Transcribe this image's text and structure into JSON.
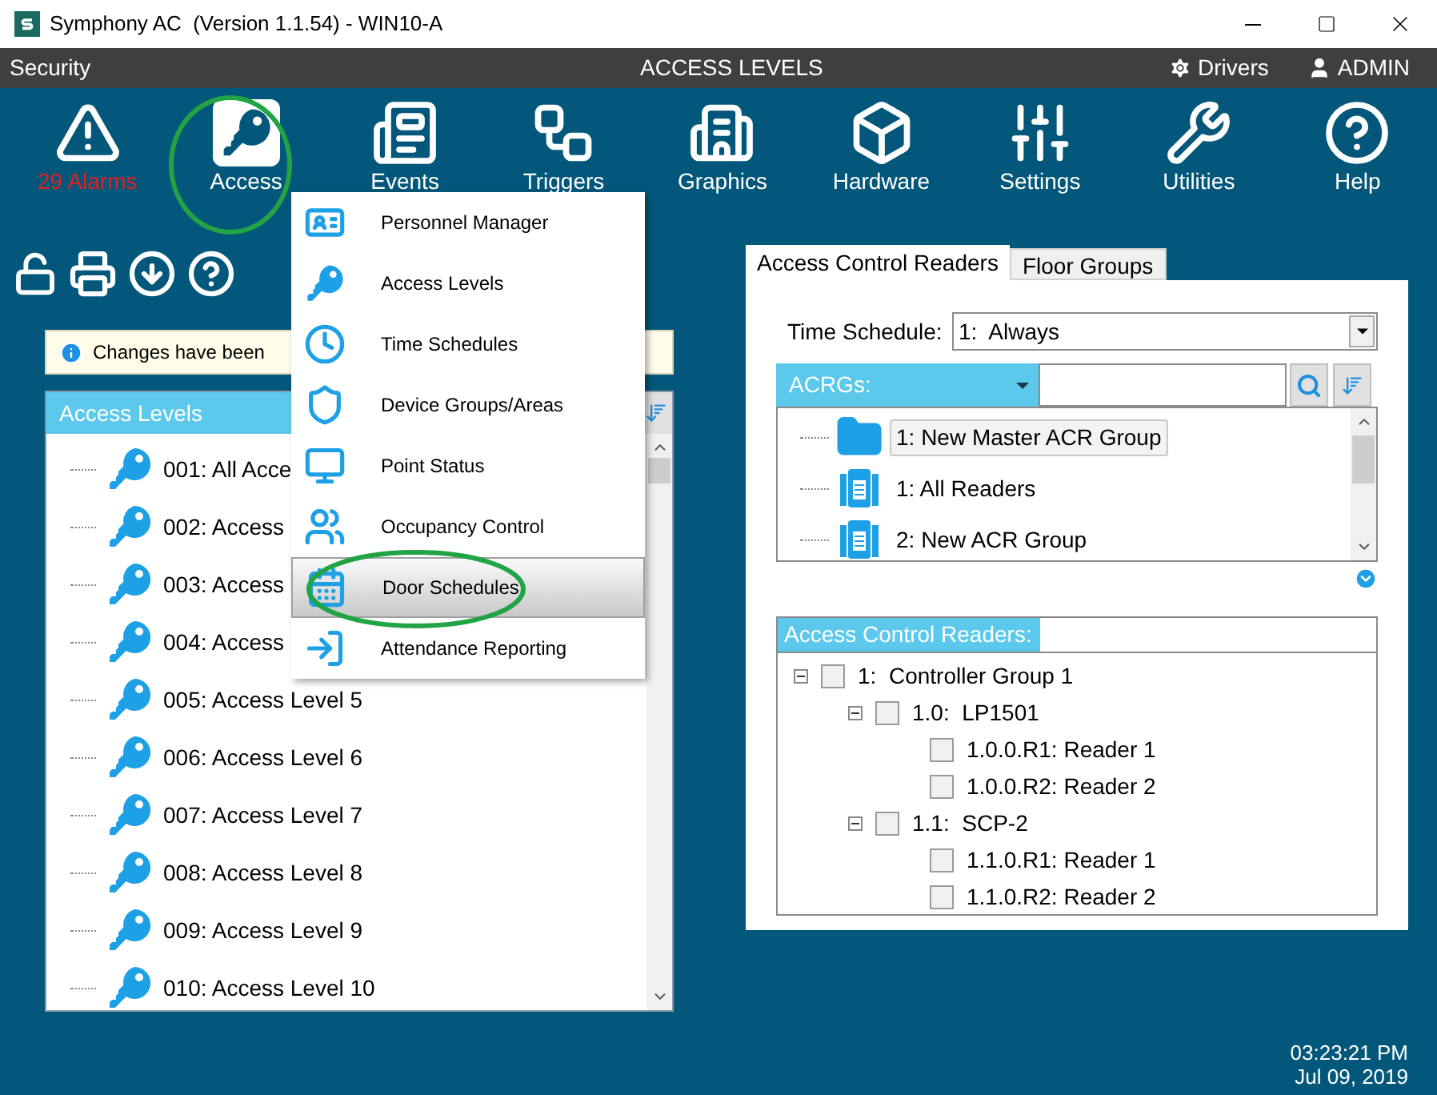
{
  "window": {
    "title": "Symphony AC  (Version 1.1.54) - WIN10-A"
  },
  "header_bar": {
    "section": "Security",
    "page_title": "ACCESS LEVELS",
    "drivers": "Drivers",
    "user": "ADMIN"
  },
  "toolbar": [
    {
      "label": "29 Alarms",
      "kind": "alarm"
    },
    {
      "label": "Access",
      "kind": "tool"
    },
    {
      "label": "Events",
      "kind": "tool"
    },
    {
      "label": "Triggers",
      "kind": "tool"
    },
    {
      "label": "Graphics",
      "kind": "tool"
    },
    {
      "label": "Hardware",
      "kind": "tool"
    },
    {
      "label": "Settings",
      "kind": "tool"
    },
    {
      "label": "Utilities",
      "kind": "tool"
    },
    {
      "label": "Help",
      "kind": "tool"
    }
  ],
  "access_menu": [
    {
      "label": "Personnel Manager",
      "selected": false
    },
    {
      "label": "Access Levels",
      "selected": false
    },
    {
      "label": "Time Schedules",
      "selected": false
    },
    {
      "label": "Device Groups/Areas",
      "selected": false
    },
    {
      "label": "Point Status",
      "selected": false
    },
    {
      "label": "Occupancy Control",
      "selected": false
    },
    {
      "label": "Door Schedules",
      "selected": true
    },
    {
      "label": "Attendance Reporting",
      "selected": false
    }
  ],
  "notice": "Changes have been",
  "access_levels": {
    "header": "Access Levels",
    "items": [
      {
        "label": "001: All Acce",
        "selected": false
      },
      {
        "label": "002: Access",
        "selected": false
      },
      {
        "label": "003: Access",
        "selected": false
      },
      {
        "label": "004: Access",
        "selected": false
      },
      {
        "label": "005: Access Level 5",
        "selected": false
      },
      {
        "label": "006: Access Level 6",
        "selected": false
      },
      {
        "label": "007: Access Level 7",
        "selected": false
      },
      {
        "label": "008: Access Level 8",
        "selected": false
      },
      {
        "label": "009: Access Level 9",
        "selected": false
      },
      {
        "label": "010: Access Level 10",
        "selected": false
      }
    ]
  },
  "tabs": [
    {
      "label": "Access Control Readers",
      "selected": true
    },
    {
      "label": "Floor Groups",
      "selected": false
    }
  ],
  "time_schedule": {
    "label": "Time Schedule:",
    "value": "1:  Always"
  },
  "acrgs": {
    "header": "ACRGs:",
    "items": [
      {
        "label": "1: New Master ACR Group",
        "kind": "folder",
        "selected": true
      },
      {
        "label": "1: All Readers",
        "kind": "reader_group",
        "selected": false
      },
      {
        "label": "2: New ACR Group",
        "kind": "reader_group",
        "selected": false
      }
    ]
  },
  "readers": {
    "header": "Access Control Readers:",
    "tree": [
      {
        "label": "1:  Controller Group 1",
        "checked": false,
        "expanded": true,
        "children": [
          {
            "label": "1.0:  LP1501",
            "checked": false,
            "expanded": true,
            "children": [
              {
                "label": "1.0.0.R1: Reader 1",
                "checked": false
              },
              {
                "label": "1.0.0.R2: Reader 2",
                "checked": false
              }
            ]
          },
          {
            "label": "1.1:  SCP-2",
            "checked": false,
            "expanded": true,
            "children": [
              {
                "label": "1.1.0.R1: Reader 1",
                "checked": false
              },
              {
                "label": "1.1.0.R2: Reader 2",
                "checked": false
              }
            ]
          }
        ]
      }
    ]
  },
  "status": {
    "time": "03:23:21 PM",
    "date": "Jul 09, 2019"
  }
}
